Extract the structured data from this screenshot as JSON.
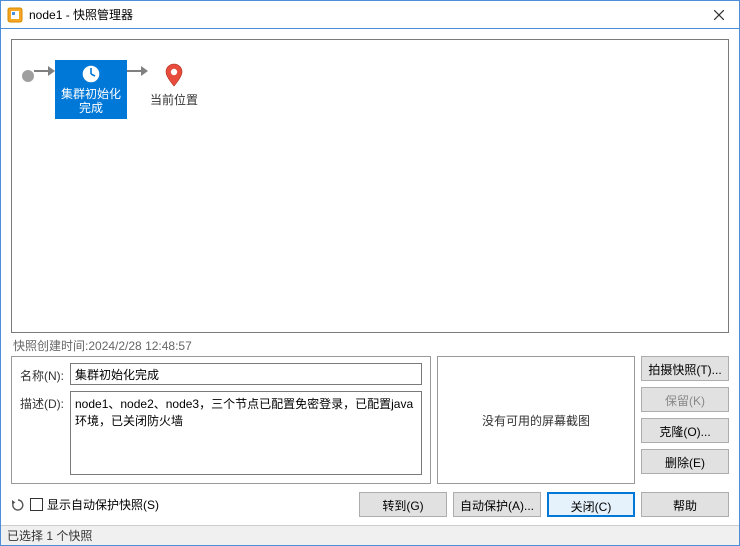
{
  "titlebar": {
    "title": "node1 - 快照管理器"
  },
  "tree": {
    "snapshot_name": "集群初始化\n完成",
    "current_position": "当前位置"
  },
  "details": {
    "created_label": "快照创建时间:",
    "created_value": "2024/2/28 12:48:57",
    "name_label": "名称(N):",
    "name_value": "集群初始化完成",
    "desc_label": "描述(D):",
    "desc_value": "node1、node2、node3，三个节点已配置免密登录，已配置java环境，已关闭防火墙",
    "screenshot_placeholder": "没有可用的屏幕截图"
  },
  "buttons": {
    "take": "拍摄快照(T)...",
    "keep": "保留(K)",
    "clone": "克隆(O)...",
    "delete": "删除(E)",
    "goto": "转到(G)",
    "auto": "自动保护(A)...",
    "close": "关闭(C)",
    "help": "帮助"
  },
  "bottom": {
    "show_auto": "显示自动保护快照(S)"
  },
  "statusbar": {
    "text": "已选择 1 个快照"
  }
}
